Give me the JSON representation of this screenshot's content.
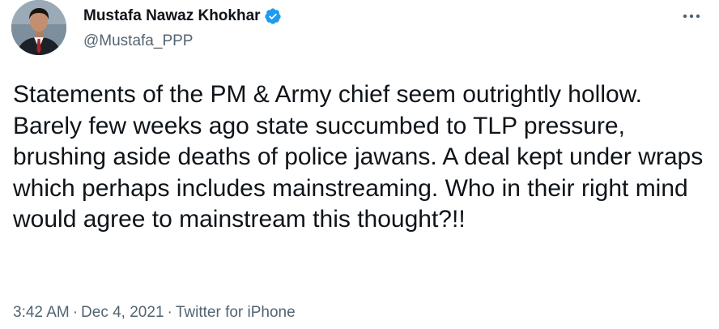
{
  "tweet": {
    "author": {
      "display_name": "Mustafa Nawaz Khokhar",
      "handle": "@Mustafa_PPP",
      "verified": true
    },
    "text": "Statements of the PM & Army chief seem outrightly hollow. Barely few weeks ago state succumbed to TLP pressure, brushing aside deaths of police jawans. A deal kept under wraps which perhaps includes mainstreaming. Who in their right mind would agree to mainstream this thought?!!",
    "time": "3:42 AM",
    "separator": "·",
    "date": "Dec 4, 2021",
    "source": "Twitter for iPhone"
  },
  "colors": {
    "text_primary": "#0f1419",
    "text_secondary": "#536471",
    "verified_blue": "#1d9bf0",
    "background": "#ffffff"
  },
  "icons": {
    "verified": "verified-badge-icon",
    "more": "more-options-icon"
  }
}
